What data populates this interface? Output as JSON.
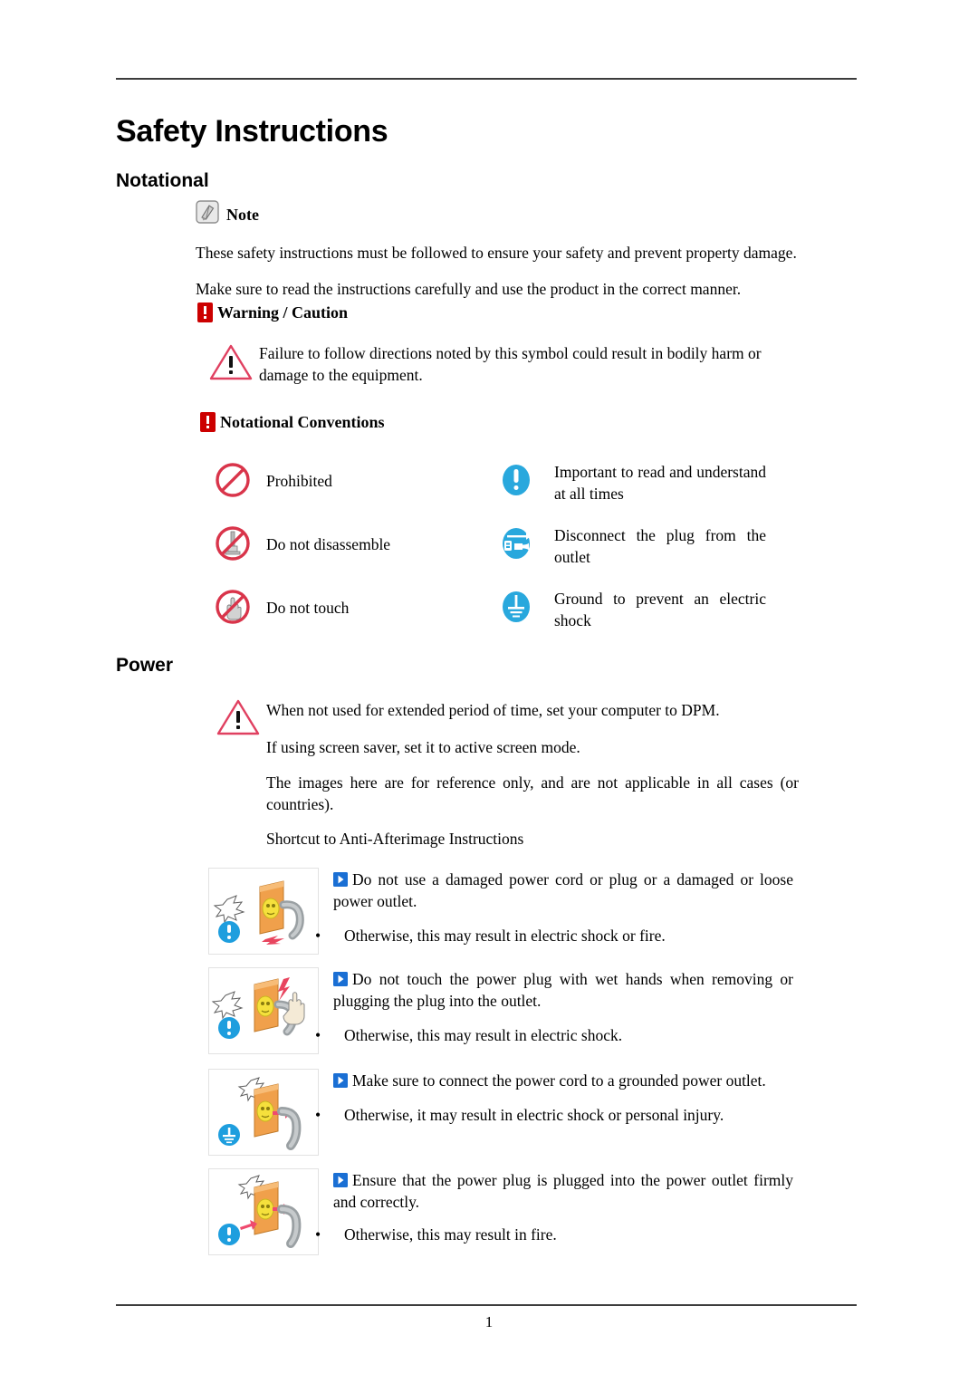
{
  "document": {
    "title": "Safety Instructions",
    "page_number": "1"
  },
  "sections": {
    "notational": {
      "heading": "Notational",
      "note_label": "Note",
      "note_icon": "note-pen-icon",
      "paragraphs": [
        "These safety instructions must be followed to ensure your safety and prevent property damage.",
        "Make sure to read the instructions carefully and use the product in the correct manner."
      ],
      "warning_caution_label": "Warning / Caution",
      "warning_caution_icon": "red-exclamation-icon",
      "warning_caution_text": "Failure to follow directions noted by this symbol could result in bodily harm or damage to the equipment.",
      "warning_triangle_icon": "warning-triangle-icon",
      "conventions_label": "Notational Conventions",
      "conventions_icon": "red-exclamation-icon",
      "conventions": [
        {
          "icon": "prohibited-icon",
          "text": "Prohibited"
        },
        {
          "icon": "important-read-icon",
          "text": "Important to read and understand at all times"
        },
        {
          "icon": "do-not-disassemble-icon",
          "text": "Do not disassemble"
        },
        {
          "icon": "disconnect-plug-icon",
          "text": "Disconnect the plug from the outlet"
        },
        {
          "icon": "do-not-touch-icon",
          "text": "Do not touch"
        },
        {
          "icon": "ground-icon",
          "text": "Ground to prevent an electric shock"
        }
      ]
    },
    "power": {
      "heading": "Power",
      "warning_triangle_icon": "warning-triangle-icon",
      "paragraphs": [
        "When not used for extended period of time, set your computer to DPM.",
        "If using screen saver, set it to active screen mode.",
        "The images here are for reference only, and are not applicable in all cases (or countries).",
        "Shortcut to Anti-Afterimage Instructions"
      ],
      "items": [
        {
          "illustration": "damaged-power-cord-illustration",
          "marker": "blue-arrow-marker",
          "heading": "Do not use a damaged power cord or plug or a damaged or loose power outlet.",
          "bullet_dot": "•",
          "bullet": "Otherwise, this may result in electric shock or fire."
        },
        {
          "illustration": "wet-hands-plug-illustration",
          "marker": "blue-arrow-marker",
          "heading": "Do not touch the power plug with wet hands when removing or plugging the plug into the outlet.",
          "bullet_dot": "•",
          "bullet": "Otherwise, this may result in electric shock."
        },
        {
          "illustration": "grounded-outlet-illustration",
          "marker": "blue-arrow-marker",
          "heading": "Make sure to connect the power cord to a grounded power outlet.",
          "bullet_dot": "•",
          "bullet": "Otherwise, it may result in electric shock or personal injury."
        },
        {
          "illustration": "firm-plug-illustration",
          "marker": "blue-arrow-marker",
          "heading": "Ensure that the power plug is plugged into the power outlet firmly and correctly.",
          "bullet_dot": "•",
          "bullet": "Otherwise, this may result in fire."
        }
      ]
    }
  },
  "colors": {
    "red": "#cc0000",
    "warning_red": "#e02b4b",
    "blue": "#1e9ede",
    "marker_blue": "#1a6fd4",
    "rule": "#3c3c3c",
    "note_grey": "#b6b6b6"
  }
}
